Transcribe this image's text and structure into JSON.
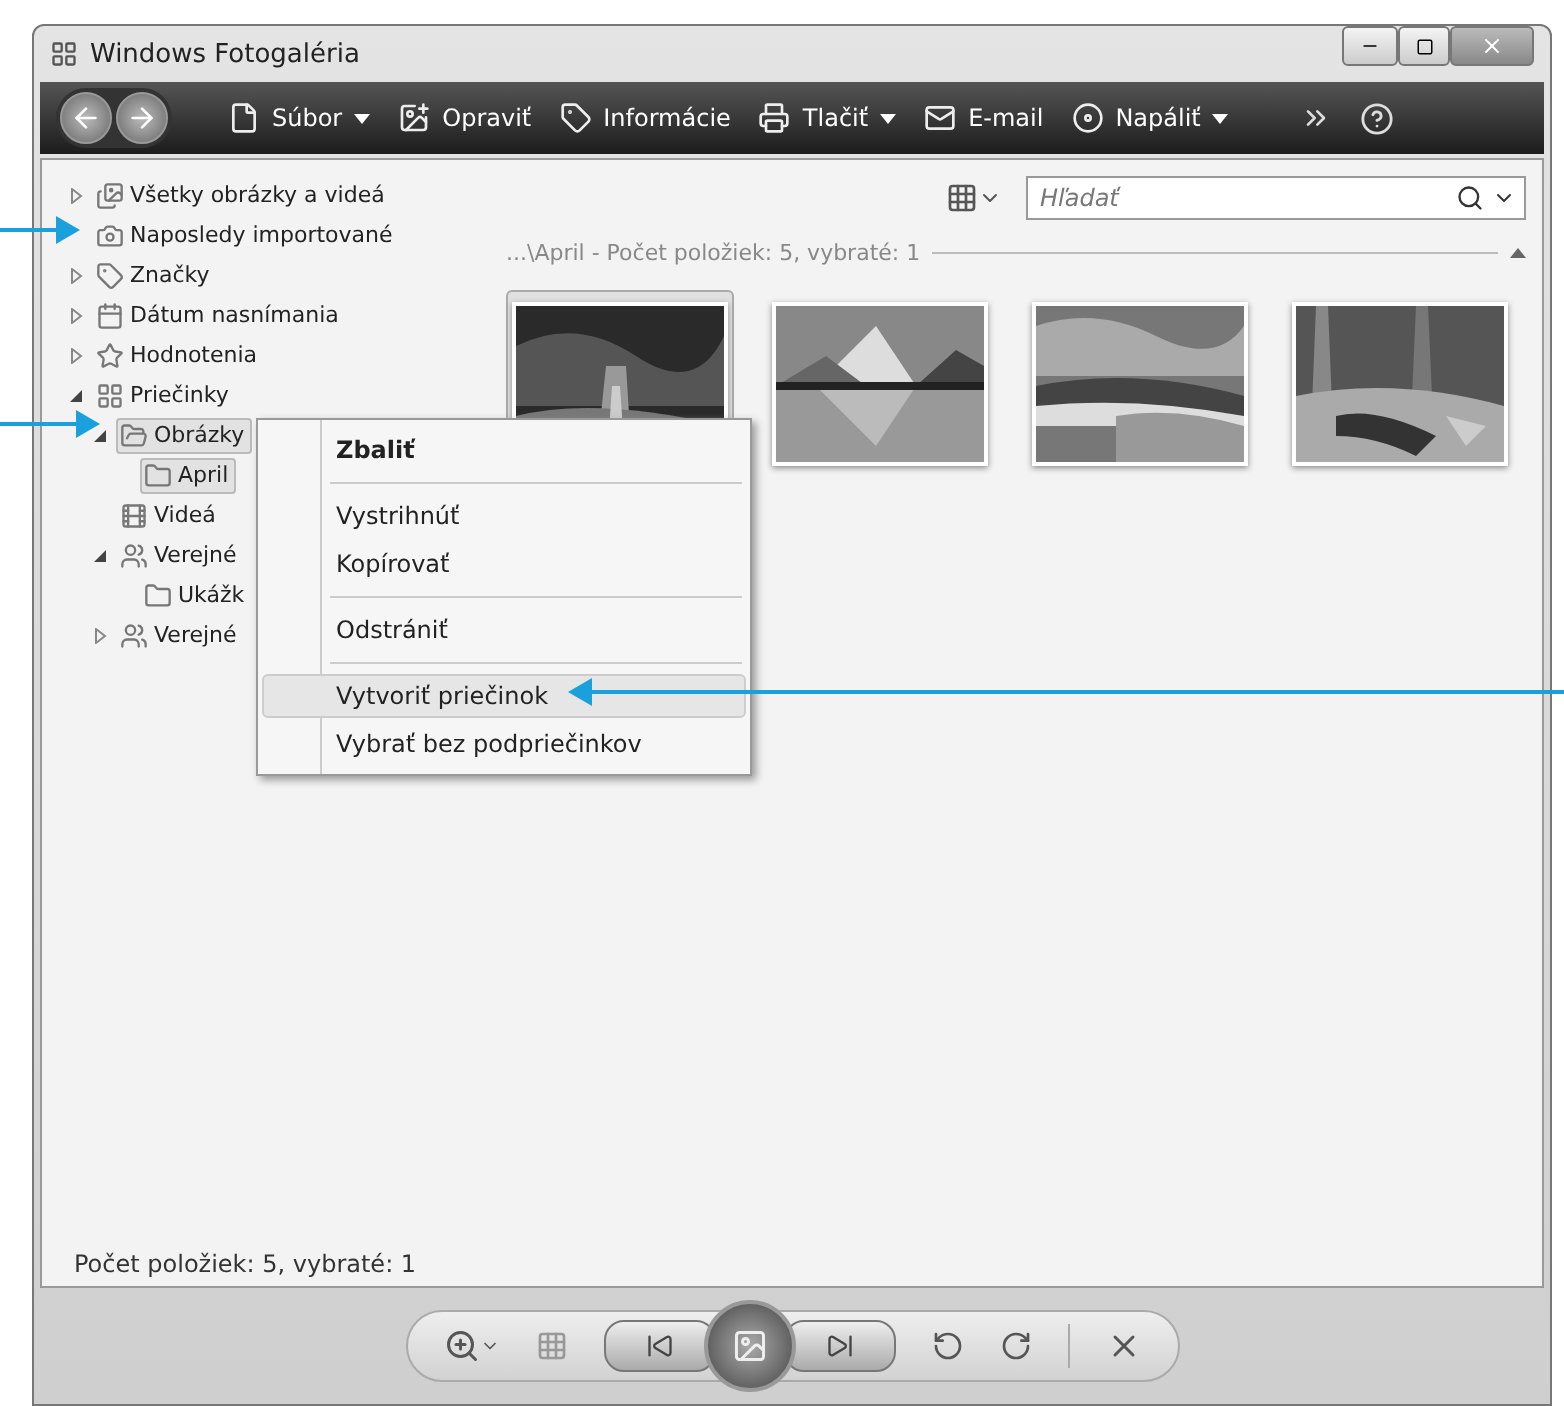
{
  "window": {
    "title": "Windows Fotogaléria"
  },
  "toolbar": [
    {
      "label": "Súbor",
      "dropdown": true
    },
    {
      "label": "Opraviť",
      "dropdown": false
    },
    {
      "label": "Informácie",
      "dropdown": false
    },
    {
      "label": "Tlačiť",
      "dropdown": true
    },
    {
      "label": "E-mail",
      "dropdown": false
    },
    {
      "label": "Napáliť",
      "dropdown": true
    }
  ],
  "tree": [
    {
      "label": "Všetky obrázky a videá",
      "expanded": false,
      "selected": false
    },
    {
      "label": "Naposledy importované",
      "selected": false
    },
    {
      "label": "Značky",
      "expanded": false,
      "selected": false
    },
    {
      "label": "Dátum nasnímania",
      "expanded": false,
      "selected": false
    },
    {
      "label": "Hodnotenia",
      "expanded": false,
      "selected": false
    },
    {
      "label": "Priečinky",
      "expanded": true,
      "selected": false,
      "children": [
        {
          "label": "Obrázky",
          "expanded": true,
          "selected": true,
          "children": [
            {
              "label": "April",
              "selected": true
            }
          ]
        },
        {
          "label": "Videá",
          "selected": false
        },
        {
          "label": "Verejné",
          "expanded": true,
          "selected": false,
          "children": [
            {
              "label": "Ukážk",
              "selected": false
            }
          ]
        },
        {
          "label": "Verejné",
          "expanded": false,
          "selected": false
        }
      ]
    }
  ],
  "search": {
    "placeholder": "Hľadať"
  },
  "gallery": {
    "header": "...\\April - Počet položiek: 5, vybraté: 1",
    "expanded": true,
    "photos": [
      {
        "kind": "picture",
        "selected": true
      },
      {
        "kind": "picture",
        "selected": false
      },
      {
        "kind": "picture",
        "selected": false
      },
      {
        "kind": "picture",
        "selected": false
      }
    ]
  },
  "context_menu": [
    {
      "kind": "item",
      "label": "Zbaliť",
      "default": true,
      "selected": false
    },
    {
      "kind": "separator"
    },
    {
      "kind": "item",
      "label": "Vystrihnúť",
      "default": false,
      "selected": false
    },
    {
      "kind": "item",
      "label": "Kopírovať",
      "default": false,
      "selected": false
    },
    {
      "kind": "separator"
    },
    {
      "kind": "item",
      "label": "Odstrániť",
      "default": false,
      "selected": false
    },
    {
      "kind": "separator"
    },
    {
      "kind": "item",
      "label": "Vytvoriť priečinok",
      "default": false,
      "selected": true
    },
    {
      "kind": "item",
      "label": "Vybrať bez podpriečinkov",
      "default": false,
      "selected": false
    }
  ],
  "status_bar": "Počet položiek: 5, vybraté: 1"
}
